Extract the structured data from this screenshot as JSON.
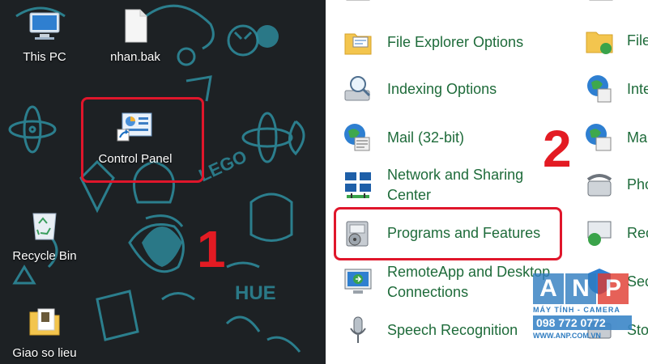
{
  "desktop": {
    "icons": [
      {
        "label": "This PC",
        "icon": "computer-icon"
      },
      {
        "label": "nhan.bak",
        "icon": "file-icon"
      },
      {
        "label": "Control Panel",
        "icon": "control-panel-icon"
      },
      {
        "label": "Recycle Bin",
        "icon": "recycle-bin-icon"
      },
      {
        "label": "Giao so lieu",
        "icon": "folder-icon"
      }
    ],
    "step_number": "1"
  },
  "control_panel": {
    "items": [
      {
        "label": "File Explorer Options",
        "icon": "file-explorer-options-icon"
      },
      {
        "label": "Indexing Options",
        "icon": "indexing-options-icon"
      },
      {
        "label": "Mail (32-bit)",
        "icon": "mail-icon"
      },
      {
        "label": "Network and Sharing Center",
        "icon": "network-icon"
      },
      {
        "label": "Programs and Features",
        "icon": "programs-features-icon"
      },
      {
        "label": "RemoteApp and Desktop Connections",
        "icon": "remoteapp-icon"
      },
      {
        "label": "Speech Recognition",
        "icon": "speech-icon"
      }
    ],
    "column2": [
      "File",
      "Inte",
      "Ma",
      "Pho",
      "Rec",
      "Sec",
      "Sto"
    ],
    "step_number": "2"
  },
  "watermark": {
    "letters": [
      "A",
      "N",
      "P"
    ],
    "subtitle": "MÁY TÍNH - CAMERA",
    "phone": "098 772 0772",
    "web": "WWW.ANP.COM.VN"
  },
  "colors": {
    "highlight": "#e0162b",
    "step": "#e31b23",
    "link_text": "#1e6b3a",
    "desktop_bg": "#1d2124",
    "doodle": "#2e8fa0"
  }
}
